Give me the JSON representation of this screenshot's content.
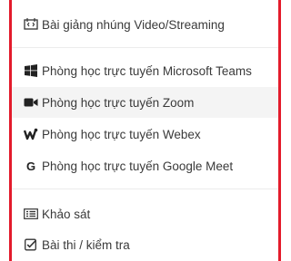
{
  "menu": {
    "items": [
      {
        "label": "Bài giảng nhúng Video/Streaming",
        "icon": "embed-video-icon"
      },
      {
        "label": "Phòng học trực tuyến Microsoft Teams",
        "icon": "windows-icon"
      },
      {
        "label": "Phòng học trực tuyến Zoom",
        "icon": "video-camera-icon",
        "hovered": true
      },
      {
        "label": "Phòng học trực tuyến Webex",
        "icon": "webex-icon"
      },
      {
        "label": "Phòng học trực tuyến Google Meet",
        "icon": "google-icon"
      },
      {
        "label": "Khảo sát",
        "icon": "survey-icon"
      },
      {
        "label": "Bài thi / kiểm tra",
        "icon": "checkbox-icon"
      }
    ]
  },
  "colors": {
    "accent_border": "#e31b2b",
    "hover_bg": "#f4f4f4",
    "text": "#3a3a3a"
  }
}
